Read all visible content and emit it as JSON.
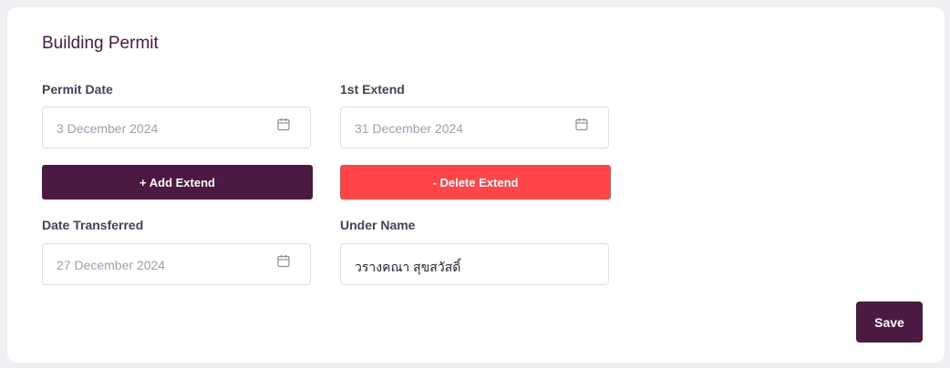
{
  "form": {
    "title": "Building Permit",
    "permit_date": {
      "label": "Permit Date",
      "value": "3 December 2024"
    },
    "first_extend": {
      "label": "1st Extend",
      "value": "31 December 2024"
    },
    "add_extend_label": "+ Add Extend",
    "delete_extend_label": "- Delete Extend",
    "date_transferred": {
      "label": "Date Transferred",
      "value": "27 December 2024"
    },
    "under_name": {
      "label": "Under Name",
      "value": "วรางคณา สุขสวัสดิ์"
    },
    "save_label": "Save"
  },
  "icons": {
    "date_picker": "calendar-icon"
  },
  "colors": {
    "primary": "#4b1942",
    "danger": "#ff4548",
    "background": "#eef0f4",
    "card": "#ffffff",
    "placeholder_text": "#9aa1b5",
    "label_text": "#3f4557"
  }
}
